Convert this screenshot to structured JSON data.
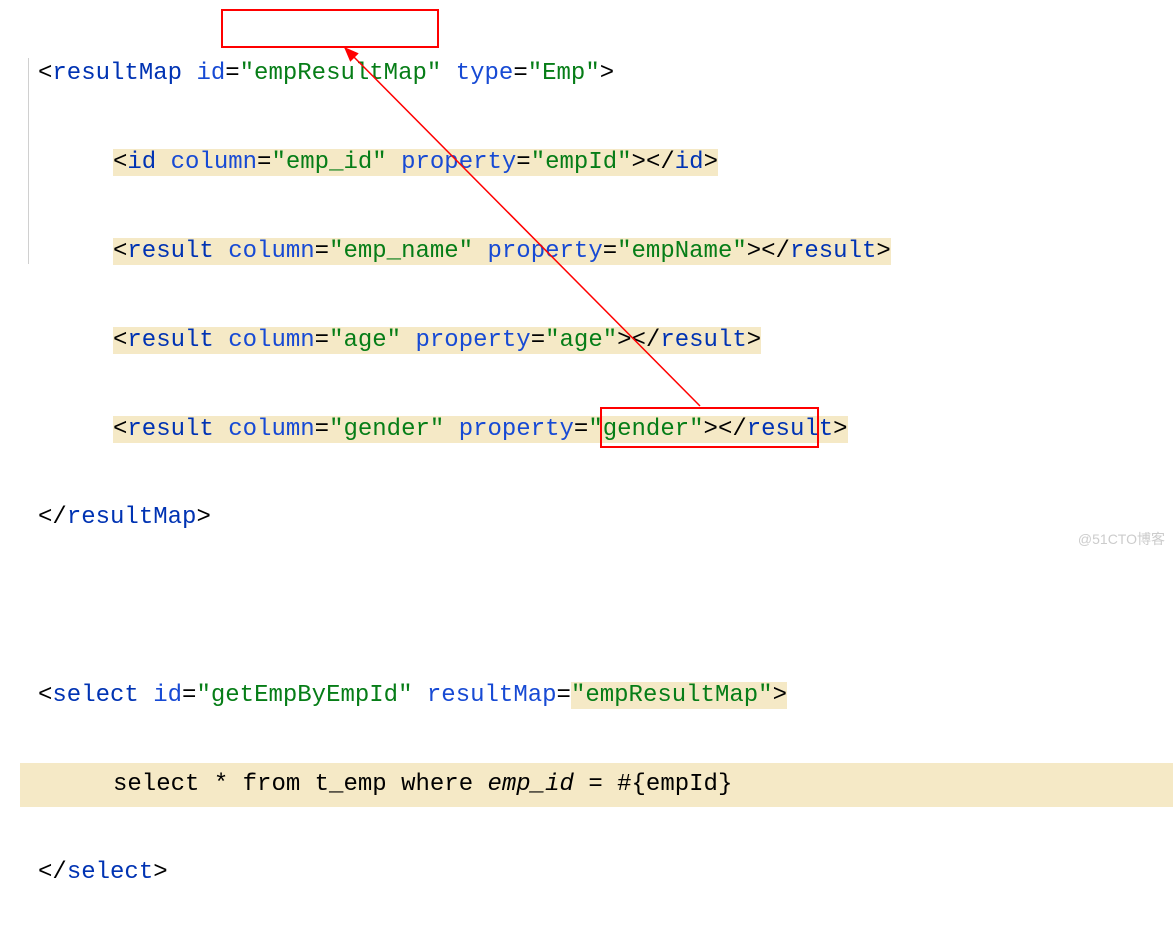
{
  "code": {
    "line1": {
      "open": "<",
      "tag": "resultMap",
      "sp1": " ",
      "attr1": "id",
      "eq1": "=",
      "val1": "\"empResultMap\"",
      "sp2": " ",
      "attr2": "type",
      "eq2": "=",
      "val2": "\"Emp\"",
      "close": ">"
    },
    "line2": {
      "open": "<",
      "tag": "id",
      "sp1": " ",
      "attr1": "column",
      "eq1": "=",
      "val1": "\"emp_id\"",
      "sp2": " ",
      "attr2": "property",
      "eq2": "=",
      "val2": "\"empId\"",
      "close": ">",
      "open2": "</",
      "tag2": "id",
      "close2": ">"
    },
    "line3": {
      "open": "<",
      "tag": "result",
      "sp1": " ",
      "attr1": "column",
      "eq1": "=",
      "val1": "\"emp_name\"",
      "sp2": " ",
      "attr2": "property",
      "eq2": "=",
      "val2": "\"empName\"",
      "close": ">",
      "open2": "</",
      "tag2": "result",
      "close2": ">"
    },
    "line4": {
      "open": "<",
      "tag": "result",
      "sp1": " ",
      "attr1": "column",
      "eq1": "=",
      "val1": "\"age\"",
      "sp2": " ",
      "attr2": "property",
      "eq2": "=",
      "val2": "\"age\"",
      "close": ">",
      "open2": "</",
      "tag2": "result",
      "close2": ">"
    },
    "line5": {
      "open": "<",
      "tag": "result",
      "sp1": " ",
      "attr1": "column",
      "eq1": "=",
      "val1": "\"gender\"",
      "sp2": " ",
      "attr2": "property",
      "eq2": "=",
      "val2": "\"gender\"",
      "close": ">",
      "open2": "</",
      "tag2": "result",
      "close2": ">"
    },
    "line6": {
      "open": "</",
      "tag": "resultMap",
      "close": ">"
    },
    "line8": {
      "open": "<",
      "tag": "select",
      "sp1": " ",
      "attr1": "id",
      "eq1": "=",
      "val1": "\"getEmpByEmpId\"",
      "sp2": " ",
      "attr2": "resultMap",
      "eq2": "=",
      "val2": "\"empResultMap\"",
      "close": ">"
    },
    "line9": {
      "t1": "select",
      "t2": " * ",
      "t3": "from",
      "t4": " t_emp ",
      "t5": "where",
      "t6": " ",
      "t7": "emp_id",
      "t8": " = #{empId}"
    },
    "line10": {
      "open": "</",
      "tag": "select",
      "close": ">"
    }
  },
  "watermark": "@51CTO博客"
}
